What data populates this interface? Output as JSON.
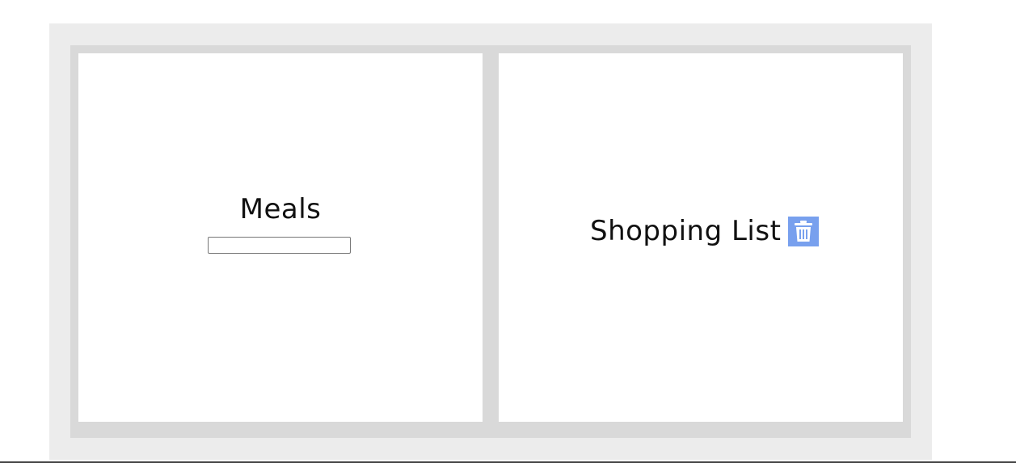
{
  "meals": {
    "title": "Meals",
    "input_value": "",
    "input_placeholder": ""
  },
  "shopping_list": {
    "title": "Shopping List",
    "delete_icon": "trash-icon"
  },
  "colors": {
    "page_background": "#ffffff",
    "outer_frame": "#ececec",
    "inner_frame": "#d9d9d9",
    "panel_background": "#ffffff",
    "trash_button": "#78a0ee",
    "trash_icon": "#ffffff"
  }
}
